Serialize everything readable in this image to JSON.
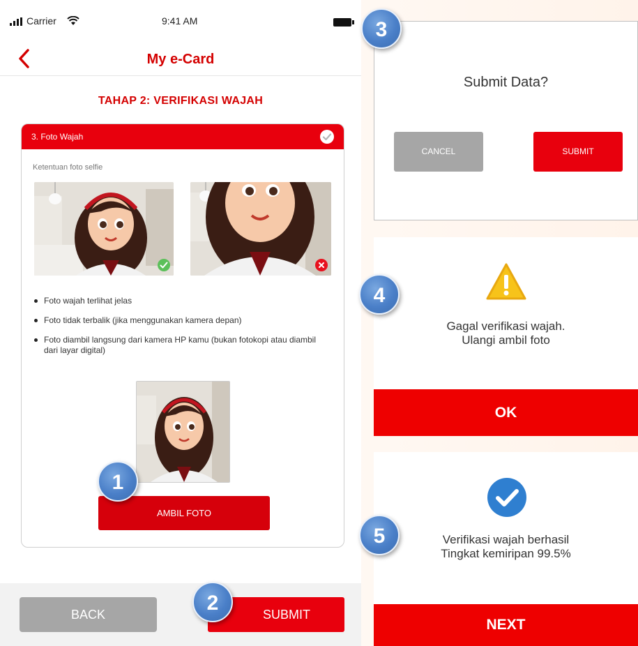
{
  "status_bar": {
    "carrier": "Carrier",
    "time": "9:41 AM"
  },
  "nav": {
    "title": "My e-Card"
  },
  "step_title": "TAHAP 2: VERIFIKASI WAJAH",
  "card": {
    "header_label": "3. Foto Wajah",
    "rules_title": "Ketentuan foto selfie",
    "rules": [
      "Foto wajah terlihat jelas",
      "Foto tidak terbalik (jika menggunakan kamera depan)",
      "Foto diambil langsung dari kamera HP kamu (bukan fotokopi atau diambil dari layar digital)"
    ],
    "ambil_label": "AMBIL FOTO"
  },
  "footer": {
    "back_label": "BACK",
    "submit_label": "SUBMIT"
  },
  "dialog_submit": {
    "title": "Submit Data?",
    "cancel_label": "CANCEL",
    "submit_label": "SUBMIT"
  },
  "dialog_fail": {
    "line1": "Gagal verifikasi wajah.",
    "line2": "Ulangi ambil foto",
    "ok_label": "OK"
  },
  "dialog_success": {
    "line1": "Verifikasi wajah berhasil",
    "line2": "Tingkat kemiripan 99.5%",
    "next_label": "NEXT"
  },
  "markers": [
    "1",
    "2",
    "3",
    "4",
    "5"
  ],
  "colors": {
    "brand_red": "#e8000d",
    "grey_button": "#a6a6a6",
    "marker_blue": "#4a7fc8",
    "success_blue": "#2f7fd0",
    "warning_yellow": "#f7c31a"
  }
}
